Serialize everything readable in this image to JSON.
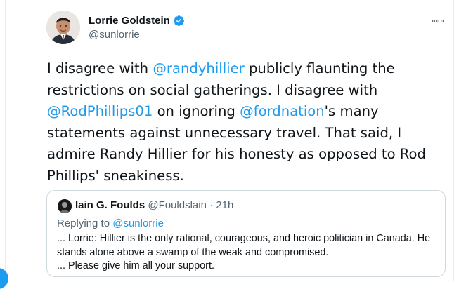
{
  "author": {
    "display_name": "Lorrie Goldstein",
    "handle": "@sunlorrie",
    "verified": true
  },
  "icons": {
    "more": "more-options-icon",
    "verified": "verified-badge-icon"
  },
  "tweet": {
    "segments": [
      {
        "text": "I disagree with ",
        "mention": false
      },
      {
        "text": "@randyhillier",
        "mention": true
      },
      {
        "text": " publicly flaunting the restrictions on social gatherings. I disagree with ",
        "mention": false
      },
      {
        "text": "@RodPhillips01",
        "mention": true
      },
      {
        "text": " on ignoring ",
        "mention": false
      },
      {
        "text": "@fordnation",
        "mention": true
      },
      {
        "text": "'s many statements against unnecessary travel.  That said, I admire Randy Hillier for his honesty as opposed to Rod Phillips' sneakiness.",
        "mention": false
      }
    ]
  },
  "quote": {
    "display_name": "Iain G. Foulds",
    "meta": "@Fouldslain · 21h",
    "replying_label": "Replying to ",
    "replying_handle": "@sunlorrie",
    "body_lines": [
      "... Lorrie: Hillier is the only rational, courageous, and heroic politician in Canada. He",
      "stands alone above a swamp of the weak and compromised.",
      "... Please give him all your support."
    ]
  },
  "colors": {
    "accent": "#1d9bf0",
    "text": "#0f1419",
    "secondary": "#536471",
    "border": "#cfd9de"
  }
}
